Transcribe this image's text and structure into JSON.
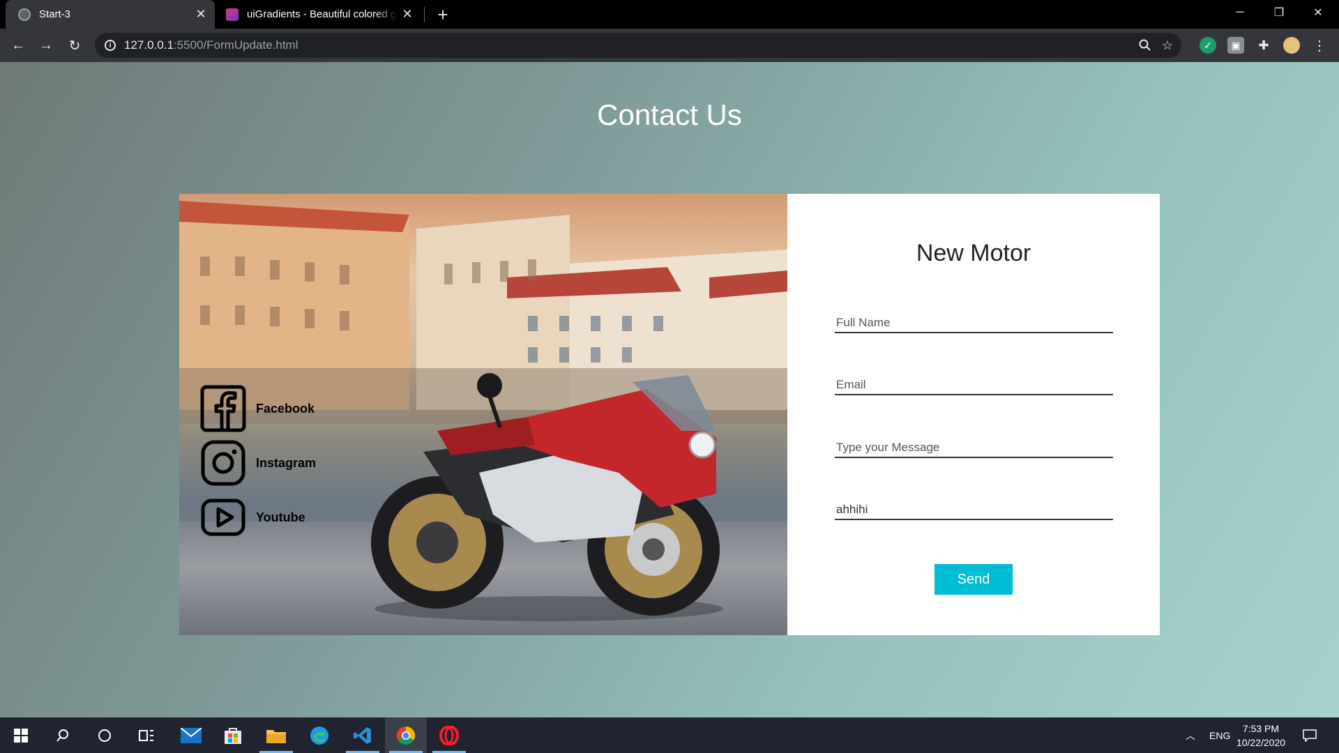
{
  "browser": {
    "tabs": [
      {
        "title": "Start-3",
        "active": true
      },
      {
        "title": "uiGradients - Beautiful colored gradients",
        "active": false
      }
    ],
    "url_host": "127.0.0.1",
    "url_path": ":5500/FormUpdate.html"
  },
  "page": {
    "heading": "Contact Us",
    "social": [
      {
        "label": "Facebook",
        "icon": "facebook-icon"
      },
      {
        "label": "Instagram",
        "icon": "instagram-icon"
      },
      {
        "label": "Youtube",
        "icon": "youtube-icon"
      }
    ],
    "form": {
      "title": "New Motor",
      "fields": [
        {
          "placeholder": "Full Name",
          "value": ""
        },
        {
          "placeholder": "Email",
          "value": ""
        },
        {
          "placeholder": "Type your Message",
          "value": ""
        },
        {
          "placeholder": "",
          "value": "ahhihi"
        }
      ],
      "send_label": "Send"
    }
  },
  "taskbar": {
    "language": "ENG",
    "time": "7:53 PM",
    "date": "10/22/2020"
  },
  "colors": {
    "send_button": "#00bcd4",
    "page_gradient_start": "#6f7a78",
    "page_gradient_end": "#a7d2cc"
  }
}
